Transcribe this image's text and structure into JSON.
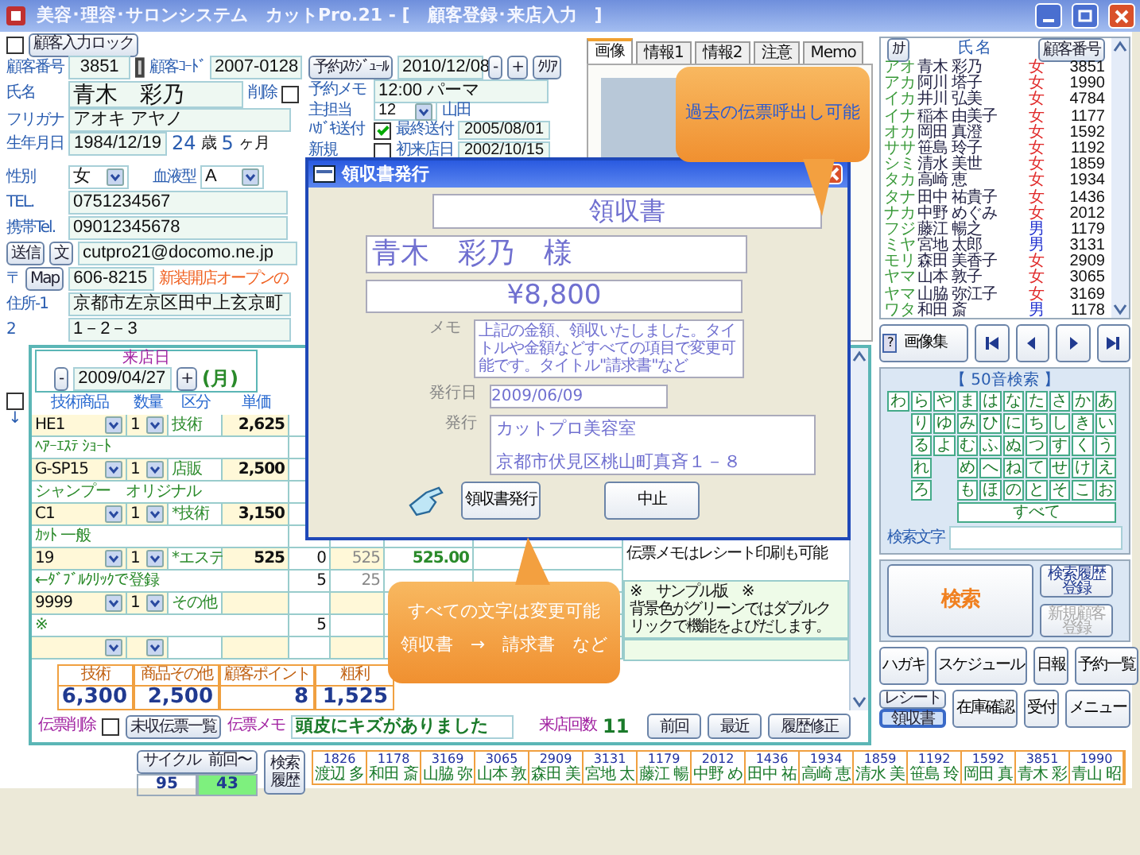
{
  "window": {
    "title": "美容･理容･サロンシステム　カットPro.21 - [　顧客登録･来店入力　]"
  },
  "input_lock": {
    "label": "顧客入力ロック",
    "checked": false
  },
  "customer": {
    "number_label": "顧客番号",
    "number": "3851",
    "code_label": "顧客ｺｰﾄﾞ",
    "code": "2007-0128",
    "name_label": "氏名",
    "name": "青木　彩乃",
    "delete": {
      "label": "削除",
      "checked": false
    },
    "kana_label": "フリガナ",
    "kana": "アオキ アヤノ",
    "birth_label": "生年月日",
    "birth": "1984/12/19",
    "age": "24",
    "age_unit": "歳",
    "months": "5",
    "months_unit": "ヶ月",
    "sex_label": "性別",
    "sex": "女",
    "blood_label": "血液型",
    "blood": "A",
    "tel_label": "TEL.",
    "tel": "0751234567",
    "mobile_label": "携帯Tel.",
    "mobile": "09012345678",
    "send_button": "送信",
    "text_button": "文",
    "email": "cutpro21@docomo.ne.jp",
    "zip_label": "〒",
    "map_button": "Map",
    "zip": "606-8215",
    "notice": "新装開店オープンの",
    "address1_label": "住所-1",
    "address1": "京都市左京区田中上玄京町",
    "address2_label": "2",
    "address2": "1－2－3"
  },
  "reservation": {
    "schedule_button": "予約ｽｹｼﾞｭｰﾙ",
    "date": "2010/12/08",
    "minus": "-",
    "plus": "+",
    "clear": "ｸﾘｱ",
    "memo_label": "予約メモ",
    "memo": "12:00 パーマ",
    "staff_label": "主担当",
    "staff_code": "12",
    "staff_name": "山田",
    "postcard": {
      "label": "ﾊｶﾞｷ送付",
      "checked": true
    },
    "last_sent_label": "最終送付",
    "last_sent": "2005/08/01",
    "new": {
      "label": "新規",
      "checked": false
    },
    "first_visit_label": "初来店日",
    "first_visit": "2002/10/15"
  },
  "tabs": [
    {
      "label": "画像",
      "selected": true
    },
    {
      "label": "情報1",
      "selected": false
    },
    {
      "label": "情報2",
      "selected": false
    },
    {
      "label": "注意",
      "selected": false
    },
    {
      "label": "Memo",
      "selected": false
    }
  ],
  "visit": {
    "date_label": "来店日",
    "minus": "-",
    "date": "2009/04/27",
    "plus": "+",
    "weekday": "(月)",
    "row_checkbox": {
      "checked": false
    },
    "row_arrow": "↓",
    "columns": [
      "技術商品",
      "数量",
      "区分",
      "単価"
    ],
    "items": [
      {
        "code": "HE1",
        "qty": "1",
        "category": "技術",
        "price": "2,625",
        "description": "ﾍｱｰｴｽﾃ ｼｮｰﾄ"
      },
      {
        "code": "G-SP15",
        "qty": "1",
        "category": "店販",
        "price": "2,500",
        "description": "シャンプー　オリジナル"
      },
      {
        "code": "C1",
        "qty": "1",
        "category": "*技術",
        "price": "3,150",
        "description": "ｶｯﾄ 一般"
      },
      {
        "code": "19",
        "qty": "1",
        "category": "*エステ",
        "price": "525",
        "amounts": [
          "0",
          "525",
          "525.00"
        ],
        "description": "←ﾀﾞﾌﾞﾙｸﾘｯｸで登録",
        "sub_amounts": [
          "5",
          "25"
        ]
      },
      {
        "code": "9999",
        "qty": "1",
        "category": "その他",
        "description": "※",
        "sub_amounts": [
          "5"
        ]
      }
    ],
    "totals": [
      {
        "label": "技術",
        "value": "6,300"
      },
      {
        "label": "商品その他",
        "value": "2,500"
      },
      {
        "label": "顧客ポイント",
        "value": "8"
      },
      {
        "label": "粗利",
        "value": "1,525"
      }
    ],
    "slip_note": "伝票メモはレシート印刷も可能",
    "sample_note": [
      "※　サンプル版　※",
      "背景色がグリーンではダブルクリックで機能をよびだします。"
    ],
    "slip_delete": {
      "label": "伝票削除",
      "checked": false
    },
    "unpaid_button": "未収伝票一覧",
    "slip_memo_label": "伝票メモ",
    "slip_memo": "頭皮にキズがありました",
    "visits_label": "来店回数",
    "visits": "11",
    "nav_buttons": [
      "前回",
      "最近",
      "履歴修正"
    ]
  },
  "cycle": {
    "cycle_label": "サイクル",
    "cycle": "95",
    "since_label": "前回〜",
    "since": "43",
    "history_button": "検索履歴"
  },
  "history": [
    {
      "number": "1826",
      "name": "渡辺 多"
    },
    {
      "number": "1178",
      "name": "和田 斎"
    },
    {
      "number": "3169",
      "name": "山脇 弥"
    },
    {
      "number": "3065",
      "name": "山本 敦"
    },
    {
      "number": "2909",
      "name": "森田 美"
    },
    {
      "number": "3131",
      "name": "宮地 太"
    },
    {
      "number": "1179",
      "name": "藤江 暢"
    },
    {
      "number": "2012",
      "name": "中野 め"
    },
    {
      "number": "1436",
      "name": "田中 祐"
    },
    {
      "number": "1934",
      "name": "高崎 恵"
    },
    {
      "number": "1859",
      "name": "清水 美"
    },
    {
      "number": "1192",
      "name": "笹島 玲"
    },
    {
      "number": "1592",
      "name": "岡田 真"
    },
    {
      "number": "3851",
      "name": "青木 彩"
    },
    {
      "number": "1990",
      "name": "青山 昭"
    }
  ],
  "customer_list": {
    "kana_button": "ｶﾅ",
    "name_header": "氏 名",
    "number_button": "顧客番号",
    "rows": [
      {
        "kana": "アオ",
        "name": "青木 彩乃",
        "sex": "女",
        "color": "#e02828",
        "number": "3851"
      },
      {
        "kana": "アカ",
        "name": "阿川 塔子",
        "sex": "女",
        "color": "#e02828",
        "number": "1990"
      },
      {
        "kana": "イカ",
        "name": "井川 弘美",
        "sex": "女",
        "color": "#e02828",
        "number": "4784"
      },
      {
        "kana": "イナ",
        "name": "稲本 由美子",
        "sex": "女",
        "color": "#e02828",
        "number": "1177"
      },
      {
        "kana": "オカ",
        "name": "岡田 真澄",
        "sex": "女",
        "color": "#e02828",
        "number": "1592"
      },
      {
        "kana": "ササ",
        "name": "笹島 玲子",
        "sex": "女",
        "color": "#e02828",
        "number": "1192"
      },
      {
        "kana": "シミ",
        "name": "清水 美世",
        "sex": "女",
        "color": "#e02828",
        "number": "1859"
      },
      {
        "kana": "タカ",
        "name": "高崎 恵",
        "sex": "女",
        "color": "#e02828",
        "number": "1934"
      },
      {
        "kana": "タナ",
        "name": "田中 祐貴子",
        "sex": "女",
        "color": "#e02828",
        "number": "1436"
      },
      {
        "kana": "ナカ",
        "name": "中野 めぐみ",
        "sex": "女",
        "color": "#e02828",
        "number": "2012"
      },
      {
        "kana": "フジ",
        "name": "藤江 暢之",
        "sex": "男",
        "color": "#2030d0",
        "number": "1179"
      },
      {
        "kana": "ミヤ",
        "name": "宮地 太郎",
        "sex": "男",
        "color": "#2030d0",
        "number": "3131"
      },
      {
        "kana": "モリ",
        "name": "森田 美香子",
        "sex": "女",
        "color": "#e02828",
        "number": "2909"
      },
      {
        "kana": "ヤマ",
        "name": "山本 敦子",
        "sex": "女",
        "color": "#e02828",
        "number": "3065"
      },
      {
        "kana": "ヤマ",
        "name": "山脇 弥江子",
        "sex": "女",
        "color": "#e02828",
        "number": "3169"
      },
      {
        "kana": "ワタ",
        "name": "和田 斎",
        "sex": "男",
        "color": "#2030d0",
        "number": "1178"
      }
    ]
  },
  "gallery": {
    "help_button": "?",
    "gallery_button": "画像集"
  },
  "kana_search": {
    "title": "【 50音検索 】",
    "columns": [
      [
        "わ"
      ],
      [
        "ら",
        "り",
        "る",
        "れ",
        "ろ"
      ],
      [
        "や",
        "ゆ",
        "よ"
      ],
      [
        "ま",
        "み",
        "む",
        "め",
        "も"
      ],
      [
        "は",
        "ひ",
        "ふ",
        "へ",
        "ほ"
      ],
      [
        "な",
        "に",
        "ぬ",
        "ね",
        "の"
      ],
      [
        "た",
        "ち",
        "つ",
        "て",
        "と"
      ],
      [
        "さ",
        "し",
        "す",
        "せ",
        "そ"
      ],
      [
        "か",
        "き",
        "く",
        "け",
        "こ"
      ],
      [
        "あ",
        "い",
        "う",
        "え",
        "お"
      ]
    ],
    "all_button": "すべて",
    "search_label": "検索文字",
    "search_button": "検索",
    "history_register_button": "検索履歴登録",
    "new_customer_button": {
      "label": "新規顧客登録",
      "disabled": true
    }
  },
  "function_buttons": [
    "ハガキ",
    "スケジュール",
    "日報",
    "予約一覧"
  ],
  "receipt_toggle": [
    {
      "label": "レシート",
      "selected": false
    },
    {
      "label": "領収書",
      "selected": true
    }
  ],
  "function_buttons_2": [
    "在庫確認",
    "受付",
    "メニュー"
  ],
  "dialog": {
    "title": "領収書発行",
    "doc_title": "領収書",
    "addressee": "青木　彩乃　様",
    "amount": "¥8,800",
    "memo_label": "メモ",
    "memo": "上記の金額、領収いたしました。タイトルや金額などすべての項目で変更可能です。タイトル\"請求書\"など",
    "date_label": "発行日",
    "date": "2009/06/09",
    "issuer_label": "発行",
    "issuer_lines": [
      "カットプロ美容室",
      "京都市伏見区桃山町真斉１－８"
    ],
    "buttons": [
      "領収書発行",
      "中止"
    ]
  },
  "callouts": [
    {
      "kind": "down",
      "lines": [
        "過去の伝票呼出し可能"
      ]
    },
    {
      "kind": "up",
      "lines": [
        "すべての文字は変更可能",
        "領収書　→　請求書　など"
      ]
    }
  ]
}
